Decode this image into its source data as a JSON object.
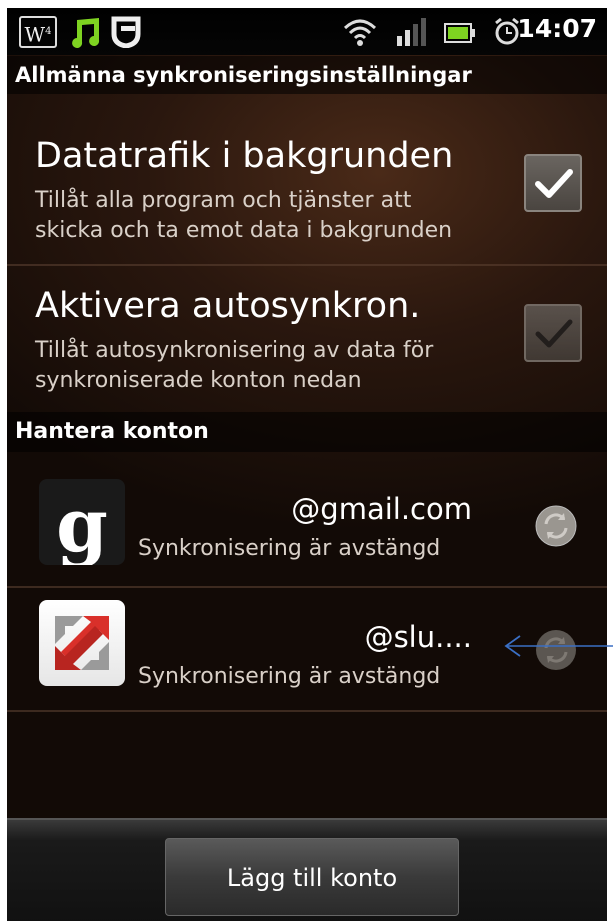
{
  "status_bar": {
    "time": "14:07",
    "w_badge": "W",
    "w_badge_sup": "4",
    "icons": [
      "w-app-icon",
      "music-note-icon",
      "shield-icon",
      "wifi-icon",
      "signal-icon",
      "battery-icon",
      "alarm-icon"
    ]
  },
  "general_section": {
    "header": "Allmänna synkroniseringsinställningar",
    "settings": [
      {
        "title": "Datatrafik i bakgrunden",
        "desc_line1": "Tillåt alla program och tjänster att",
        "desc_line2": "skicka och ta emot data i bakgrunden",
        "checked": true,
        "enabled": true
      },
      {
        "title": "Aktivera autosynkron.",
        "desc_line1": "Tillåt autosynkronisering av data för",
        "desc_line2": "synkroniserade konton nedan",
        "checked": true,
        "enabled": false
      }
    ]
  },
  "accounts_section": {
    "header": "Hantera konton",
    "accounts": [
      {
        "name": "@gmail.com",
        "status": "Synkronisering är avstängd",
        "icon": "google-icon"
      },
      {
        "name": "@slu....",
        "status": "Synkronisering är avstängd",
        "icon": "exchange-icon"
      }
    ]
  },
  "bottom_bar": {
    "add_account_label": "Lägg till konto"
  },
  "colors": {
    "background": "#2a170e",
    "annotation_arrow": "#3a6fc4"
  }
}
